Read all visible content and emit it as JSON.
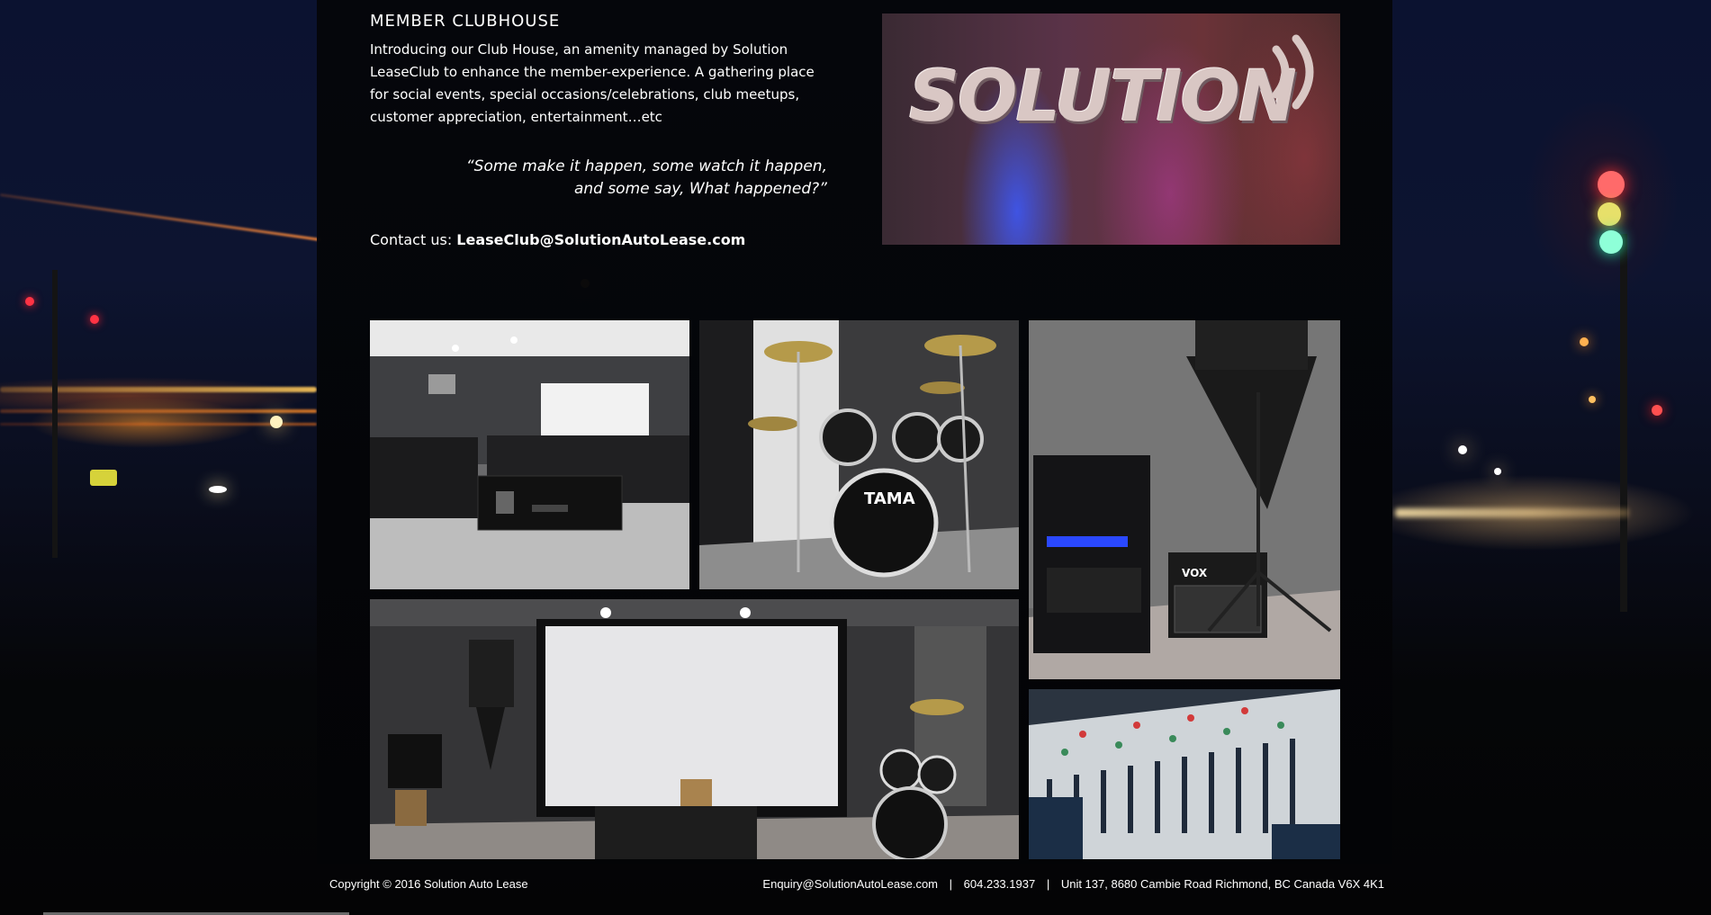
{
  "section": {
    "heading": "MEMBER CLUBHOUSE",
    "intro": "Introducing our Club House, an amenity managed by Solution LeaseClub to enhance the member-experience. A gathering place for social events, special occasions/celebrations, club meetups, customer appreciation, entertainment…etc",
    "quote_line1": "“Some make it happen, some watch it happen,",
    "quote_line2": "and some say, What happened?”",
    "contact_label": "Contact us:",
    "contact_email": "LeaseClub@SolutionAutoLease.com"
  },
  "logo": {
    "text": "SOLUTION"
  },
  "photos": {
    "lounge": {
      "icon": "lounge-photo"
    },
    "drums": {
      "icon": "drum-kit-photo",
      "brand": "TAMA"
    },
    "amp": {
      "icon": "amplifier-photo",
      "brand": "VOX"
    },
    "theater": {
      "icon": "home-theater-photo"
    },
    "mixer": {
      "icon": "mixing-console-photo"
    }
  },
  "footer": {
    "copyright": "Copyright © 2016 Solution Auto Lease",
    "email": "Enquiry@SolutionAutoLease.com",
    "separator": "|",
    "phone": "604.233.1937",
    "address": "Unit 137, 8680 Cambie Road Richmond, BC Canada V6X 4K1"
  },
  "colors": {
    "background": "#050608",
    "text": "#ffffff"
  }
}
